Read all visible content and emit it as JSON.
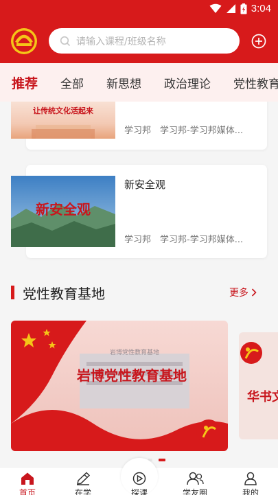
{
  "status_bar": {
    "time": "3:04"
  },
  "header": {
    "logo": "union-logo",
    "search_placeholder": "请输入课程/班级名称",
    "search_icon": "search-icon",
    "add_icon": "plus-circle-icon"
  },
  "tabs": [
    "推荐",
    "全部",
    "新思想",
    "政治理论",
    "党性教育"
  ],
  "feed": {
    "items": [
      {
        "title": "",
        "thumb_caption": "让传统文化活起来",
        "source": "学习邦",
        "publisher": "学习邦-学习邦媒体..."
      },
      {
        "title": "新安全观",
        "thumb_caption": "新安全观",
        "source": "学习邦",
        "publisher": "学习邦-学习邦媒体..."
      }
    ],
    "section": {
      "title": "党性教育基地",
      "more": "更多"
    },
    "banner": {
      "caption": "岩博党性教育基地",
      "sign": "岩博党性教育基地"
    },
    "banner_next": {
      "caption": "华书文朝"
    }
  },
  "bottom_nav": [
    {
      "label": "首页",
      "icon": "home-icon",
      "active": true
    },
    {
      "label": "在学",
      "icon": "pencil-icon",
      "active": false
    },
    {
      "label": "探课",
      "icon": "play-circle-icon",
      "active": false
    },
    {
      "label": "学友圈",
      "icon": "friends-icon",
      "active": false
    },
    {
      "label": "我的",
      "icon": "user-icon",
      "active": false
    }
  ],
  "colors": {
    "brand_red": "#d71a1b",
    "accent_red": "#c8161d",
    "tab_bg": "#fdf0ef"
  }
}
